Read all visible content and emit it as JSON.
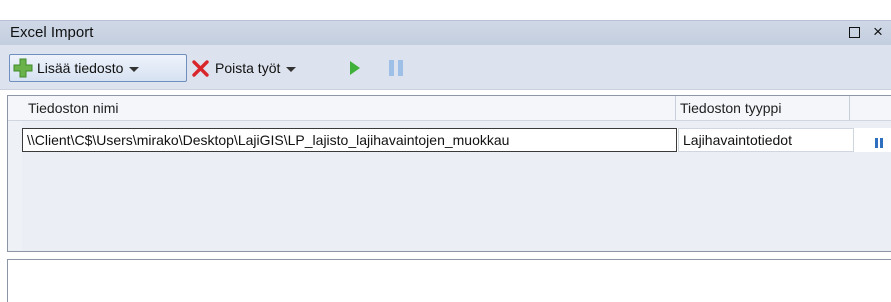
{
  "window": {
    "title": "Excel Import",
    "restore_icon": "restore-icon",
    "close_icon": "close-icon",
    "close_glyph": "×"
  },
  "toolbar": {
    "add_label": "Lisää tiedosto",
    "add_icon": "plus-icon",
    "remove_label": "Poista työt",
    "remove_icon": "delete-x-icon",
    "run_icon": "play-icon",
    "pause_icon": "pause-icon",
    "colors": {
      "plus": "#6bb24a",
      "delete": "#d8262b",
      "play": "#3fb13a",
      "pause": "#9ec0e6"
    }
  },
  "grid": {
    "columns": [
      "Tiedoston nimi",
      "Tiedoston tyyppi"
    ],
    "rows": [
      {
        "name": "\\\\Client\\C$\\Users\\mirako\\Desktop\\LajiGIS\\LP_lajisto_lajihavaintojen_muokkau",
        "type": "Lajihavaintotiedot",
        "status_icon": "pause-icon"
      }
    ]
  }
}
